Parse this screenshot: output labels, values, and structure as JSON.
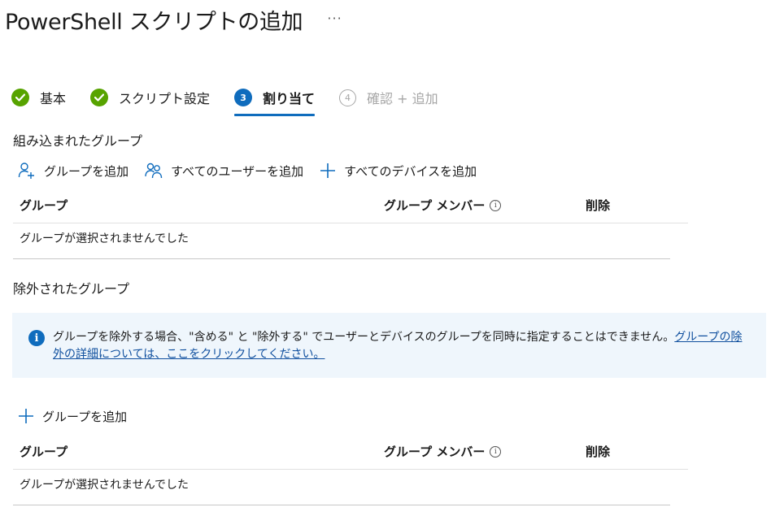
{
  "header": {
    "title": "PowerShell スクリプトの追加",
    "more": "···"
  },
  "wizard": {
    "steps": [
      {
        "number": "",
        "label": "基本",
        "state": "done"
      },
      {
        "number": "",
        "label": "スクリプト設定",
        "state": "done"
      },
      {
        "number": "3",
        "label": "割り当て",
        "state": "active"
      },
      {
        "number": "4",
        "label": "確認 + 追加",
        "state": "pending"
      }
    ]
  },
  "included": {
    "section_label": "組み込まれたグループ",
    "actions": {
      "add_group": "グループを追加",
      "add_all_users": "すべてのユーザーを追加",
      "add_all_devices": "すべてのデバイスを追加"
    },
    "columns": {
      "group": "グループ",
      "members": "グループ メンバー",
      "delete": "削除"
    },
    "empty": "グループが選択されませんでした"
  },
  "excluded": {
    "section_label": "除外されたグループ",
    "info": {
      "text": "グループを除外する場合、\"含める\" と \"除外する\" でユーザーとデバイスのグループを同時に指定することはできません。",
      "link": "グループの除外の詳細については、ここをクリックしてください。"
    },
    "actions": {
      "add_group": "グループを追加"
    },
    "columns": {
      "group": "グループ",
      "members": "グループ メンバー",
      "delete": "削除"
    },
    "empty": "グループが選択されませんでした"
  },
  "colors": {
    "accent": "#0f6cbd",
    "done": "#57a300",
    "info_bg": "#eff6fc",
    "pending": "#a6a6a6"
  }
}
